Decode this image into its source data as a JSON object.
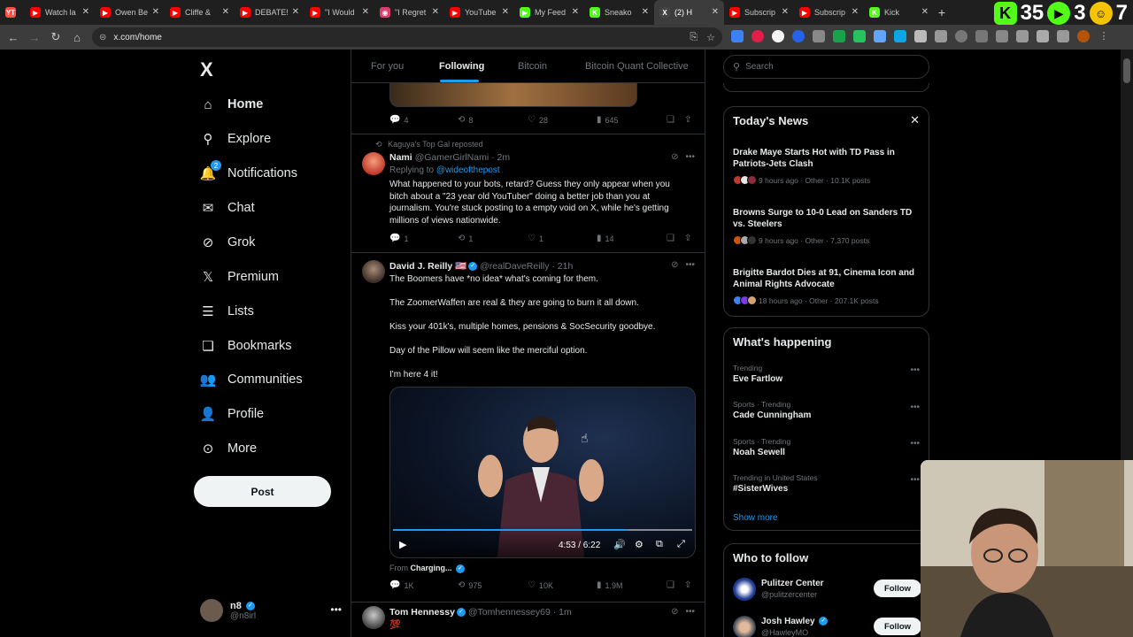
{
  "browser": {
    "tabs": [
      {
        "label": "Watch la",
        "color": "#ff0000",
        "glyph": "▶"
      },
      {
        "label": "Owen Be",
        "color": "#ff0000",
        "glyph": "▶"
      },
      {
        "label": "Cliffe &",
        "color": "#ff0000",
        "glyph": "▶"
      },
      {
        "label": "DEBATE!",
        "color": "#ff0000",
        "glyph": "▶"
      },
      {
        "label": "\"I Would",
        "color": "#ff0000",
        "glyph": "▶"
      },
      {
        "label": "\"I Regret",
        "color": "#d93f6b",
        "glyph": "◉"
      },
      {
        "label": "YouTube",
        "color": "#ff0000",
        "glyph": "▶"
      },
      {
        "label": "My Feed",
        "color": "#53fc18",
        "glyph": "▶"
      },
      {
        "label": "Sneako",
        "color": "#53fc18",
        "glyph": "K"
      },
      {
        "label": "(2) H",
        "color": "#444444",
        "glyph": "X",
        "active": true
      },
      {
        "label": "Subscrip",
        "color": "#ff0000",
        "glyph": "▶"
      },
      {
        "label": "Subscrip",
        "color": "#ff0000",
        "glyph": "▶"
      },
      {
        "label": "Kick",
        "color": "#53fc18",
        "glyph": "K"
      }
    ],
    "first_tab_glyph": "YT",
    "overlay": {
      "num1": "35",
      "num2": "3",
      "num3": "7"
    },
    "url": "x.com/home"
  },
  "sidebar": {
    "logo": "X",
    "items": [
      {
        "label": "Home",
        "icon": "home-icon",
        "glyph": "⌂",
        "active": true
      },
      {
        "label": "Explore",
        "icon": "search-icon",
        "glyph": "⚲"
      },
      {
        "label": "Notifications",
        "icon": "bell-icon",
        "glyph": "🔔",
        "badge": "2"
      },
      {
        "label": "Chat",
        "icon": "mail-icon",
        "glyph": "✉"
      },
      {
        "label": "Grok",
        "icon": "grok-icon",
        "glyph": "⊘"
      },
      {
        "label": "Premium",
        "icon": "x-icon",
        "glyph": "𝕏"
      },
      {
        "label": "Lists",
        "icon": "list-icon",
        "glyph": "☰"
      },
      {
        "label": "Bookmarks",
        "icon": "bookmark-icon",
        "glyph": "❏"
      },
      {
        "label": "Communities",
        "icon": "people-icon",
        "glyph": "👥"
      },
      {
        "label": "Profile",
        "icon": "person-icon",
        "glyph": "👤"
      },
      {
        "label": "More",
        "icon": "more-icon",
        "glyph": "⊙"
      }
    ],
    "post_label": "Post",
    "account": {
      "name": "n8",
      "handle": "@n8irl"
    }
  },
  "feed": {
    "tabs": [
      "For you",
      "Following",
      "Bitcoin",
      "Bitcoin Quant Collective"
    ],
    "prev_post_stats": {
      "replies": "4",
      "reposts": "8",
      "likes": "28",
      "views": "645"
    },
    "post1": {
      "reposted_by": "Kaguya's Top Gal reposted",
      "name": "Nami",
      "handle": "@GamerGirlNami · 2m",
      "replying_prefix": "Replying to ",
      "replying_to": "@wideofthepost",
      "text": "What happened to your bots, retard? Guess they only appear when you bitch about a \"23 year old YouTuber\" doing a better job than you at journalism. You're stuck posting to a empty void on X, while he's getting millions of views nationwide.",
      "stats": {
        "replies": "1",
        "reposts": "1",
        "likes": "1",
        "views": "14"
      }
    },
    "post2": {
      "name": "David J. Reilly 🇺🇸",
      "handle": "@realDaveReilly · 21h",
      "lines": [
        "The Boomers have *no idea* what's coming for them.",
        "The ZoomerWaffen are real & they are going to burn it all down.",
        "Kiss your 401k's, multiple homes, pensions & SocSecurity goodbye.",
        "Day of the Pillow will seem like the merciful option.",
        "I'm here 4 it!"
      ],
      "video_time": "4:53 / 6:22",
      "video_progress": 0.787,
      "from_prefix": "From ",
      "from_name": "Charging...",
      "stats": {
        "replies": "1K",
        "reposts": "975",
        "likes": "10K",
        "views": "1.9M"
      }
    },
    "post3": {
      "name": "Tom Hennessy",
      "handle": "@Tomhennessey69 · 1m",
      "text": "💯"
    }
  },
  "right": {
    "search_placeholder": "Search",
    "news": {
      "title": "Today's News",
      "items": [
        {
          "title": "Drake Maye Starts Hot with TD Pass in Patriots-Jets Clash",
          "meta": "9 hours ago · Other · 10.1K posts"
        },
        {
          "title": "Browns Surge to 10-0 Lead on Sanders TD vs. Steelers",
          "meta": "9 hours ago · Other · 7,370 posts"
        },
        {
          "title": "Brigitte Bardot Dies at 91, Cinema Icon and Animal Rights Advocate",
          "meta": "18 hours ago · Other · 207.1K posts"
        }
      ]
    },
    "happening": {
      "title": "What's happening",
      "items": [
        {
          "cat": "Trending",
          "name": "Eve Fartlow"
        },
        {
          "cat": "Sports · Trending",
          "name": "Cade Cunningham"
        },
        {
          "cat": "Sports · Trending",
          "name": "Noah Sewell"
        },
        {
          "cat": "Trending in United States",
          "name": "#SisterWives"
        }
      ],
      "show_more": "Show more"
    },
    "who_to_follow": {
      "title": "Who to follow",
      "items": [
        {
          "name": "Pulitzer Center",
          "handle": "@pulitzercenter",
          "button": "Follow"
        },
        {
          "name": "Josh Hawley",
          "handle": "@HawleyMO",
          "button": "Follow"
        }
      ]
    }
  },
  "colors": {
    "accent": "#1d9bf0",
    "border": "#2f3336",
    "muted": "#71767b"
  }
}
